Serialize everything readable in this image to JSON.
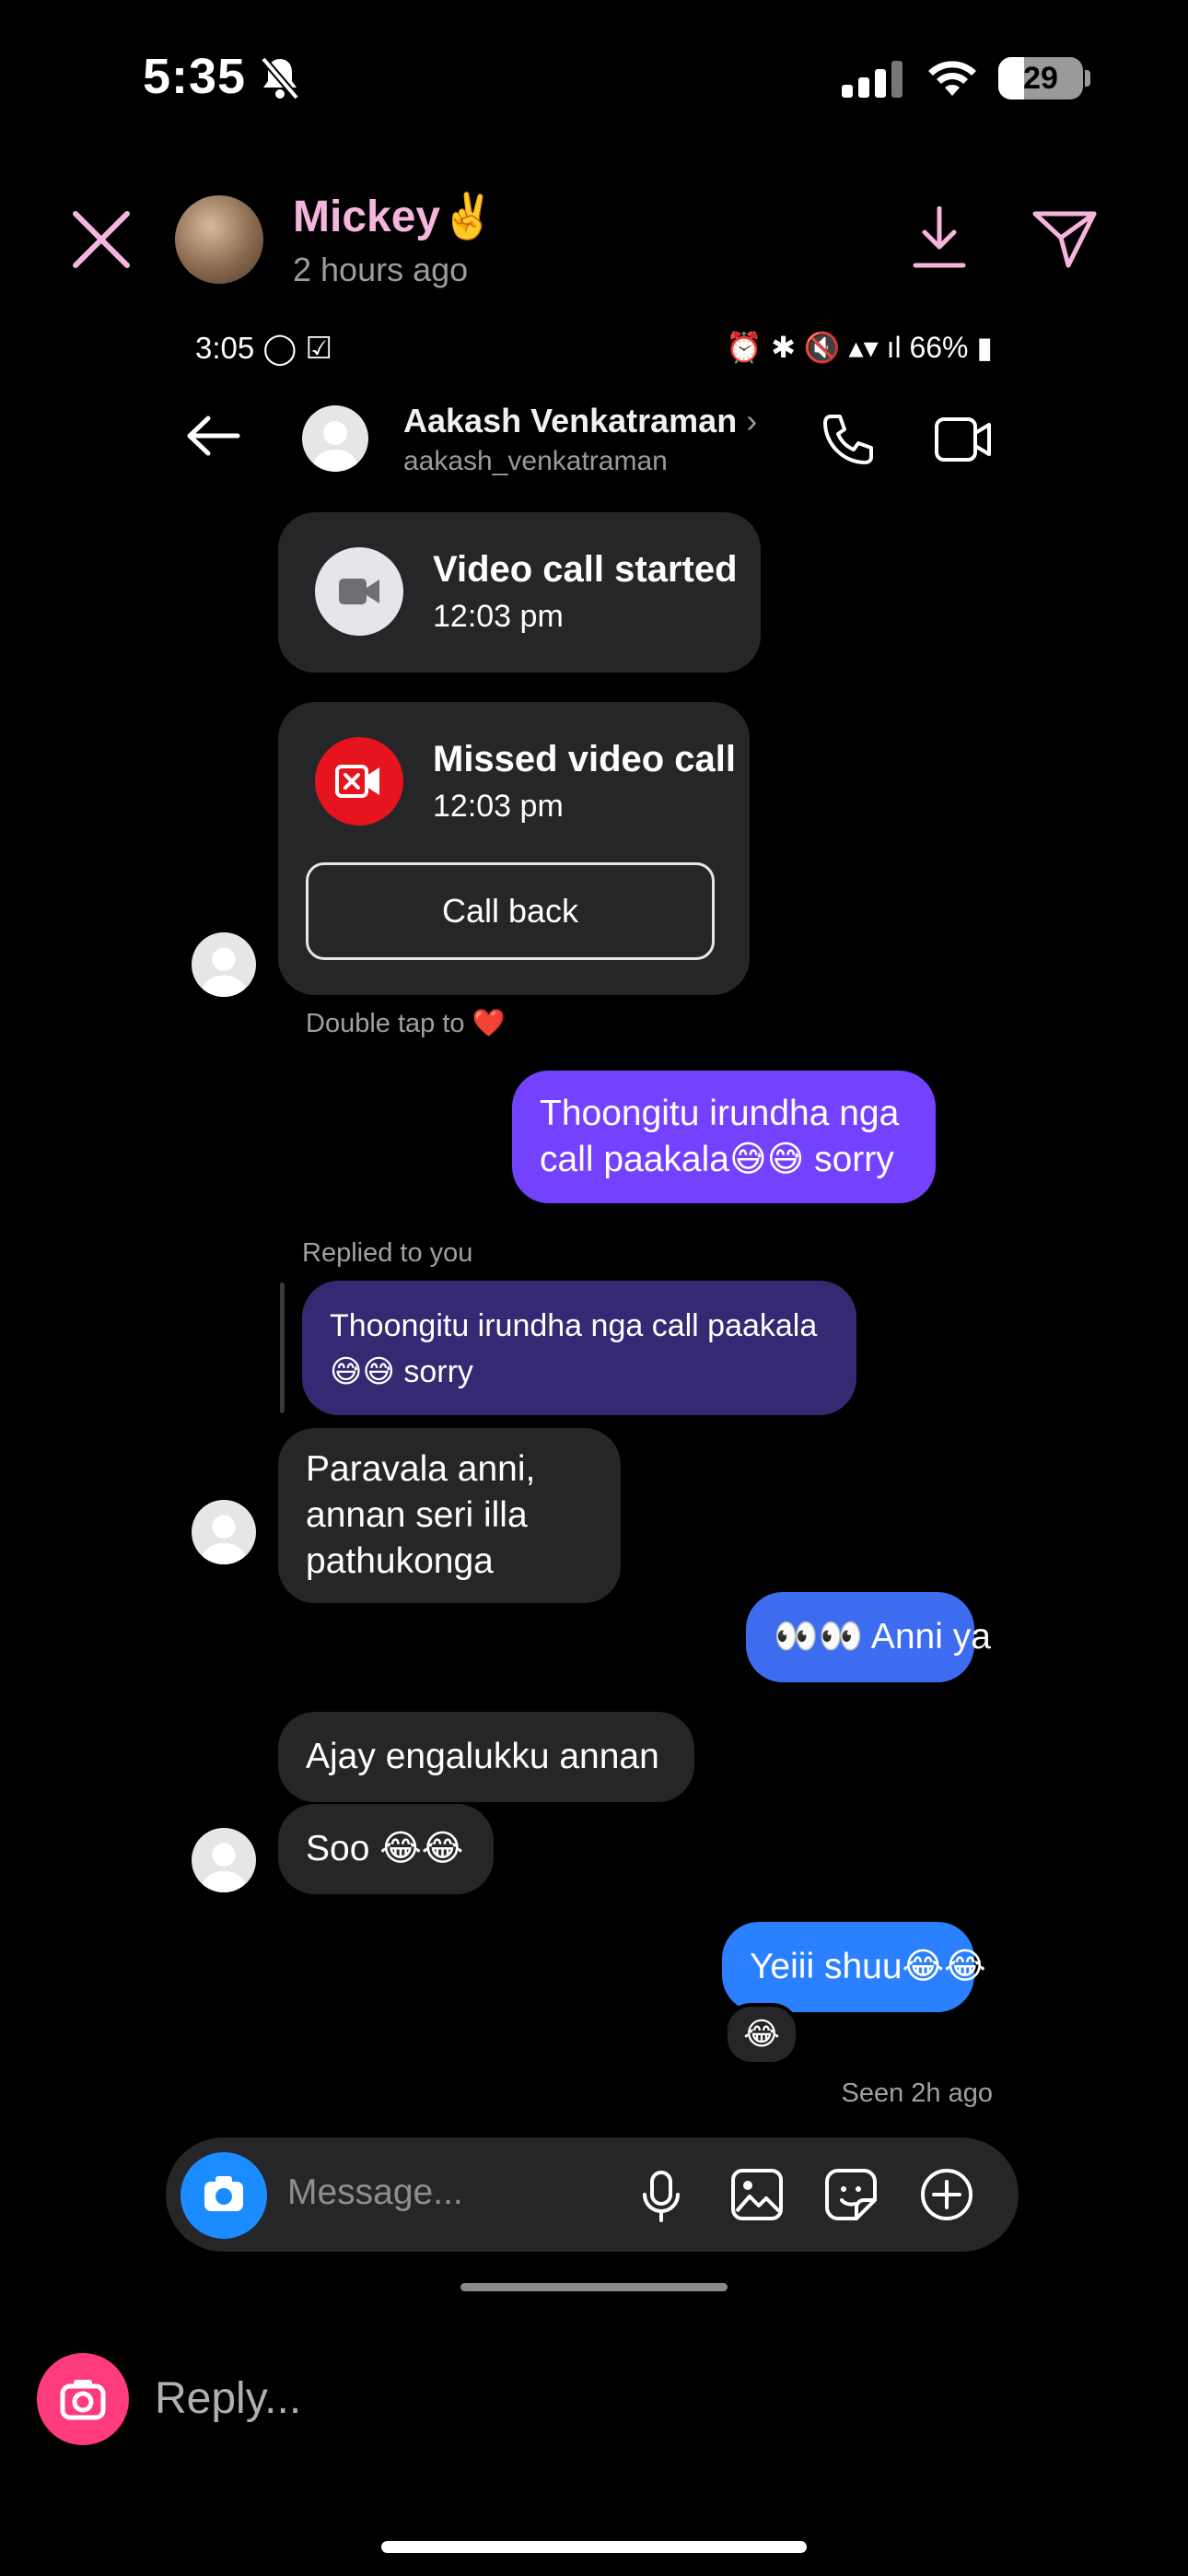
{
  "outer_status": {
    "time": "5:35",
    "battery": "29"
  },
  "story_header": {
    "name": "Mickey",
    "name_emoji": "✌️",
    "time_ago": "2 hours ago"
  },
  "inner_status": {
    "time": "3:05",
    "right_indicators": "66%"
  },
  "chat_header": {
    "contact_name": "Aakash Venkatraman",
    "handle": "aakash_venkatraman"
  },
  "messages": {
    "video_started_title": "Video call started",
    "video_started_time": "12:03 pm",
    "missed_title": "Missed video call",
    "missed_time": "12:03 pm",
    "call_back_label": "Call back",
    "double_tap": "Double tap to",
    "double_tap_emoji": "❤️",
    "sent_1": "Thoongitu irundha nga call paakala😅😅 sorry",
    "replied_label": "Replied to you",
    "quoted": "Thoongitu irundha nga call paakala😅😅 sorry",
    "recv_1": "Paravala anni, annan seri illa pathukonga",
    "sent_2": "👀👀 Anni ya",
    "recv_2": "Ajay engalukku annan",
    "recv_3": "Soo 😂😂",
    "sent_3": "Yeiii shuu😂😂",
    "reaction": "😂",
    "seen": "Seen 2h ago"
  },
  "composer": {
    "placeholder": "Message..."
  },
  "reply_bar": {
    "placeholder": "Reply..."
  },
  "colors": {
    "story_name": "#f5b5dd",
    "sent_purple": "#7442ff",
    "sent_blue": "#3d6cf0",
    "sent_blue2": "#2a80ff",
    "reply_cam": "#ff3b7f"
  }
}
